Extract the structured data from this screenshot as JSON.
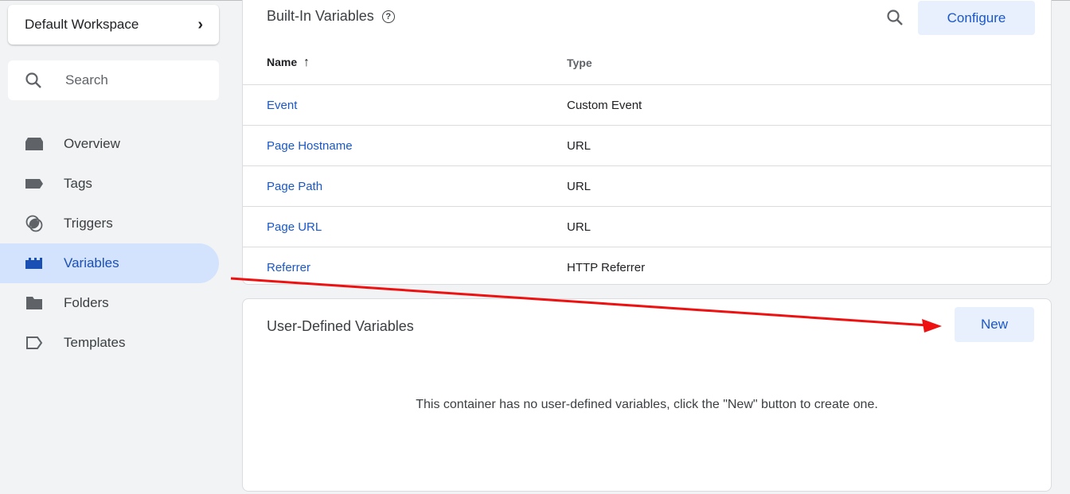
{
  "sidebar": {
    "workspace": {
      "label": "Default Workspace",
      "chevron_icon": "chevron-right-icon"
    },
    "search": {
      "placeholder": "Search",
      "icon": "search-icon"
    },
    "items": [
      {
        "label": "Overview",
        "icon": "overview-icon",
        "active": false
      },
      {
        "label": "Tags",
        "icon": "tag-icon",
        "active": false
      },
      {
        "label": "Triggers",
        "icon": "trigger-icon",
        "active": false
      },
      {
        "label": "Variables",
        "icon": "variables-icon",
        "active": true
      },
      {
        "label": "Folders",
        "icon": "folder-icon",
        "active": false
      },
      {
        "label": "Templates",
        "icon": "template-icon",
        "active": false
      }
    ]
  },
  "builtin": {
    "title": "Built-In Variables",
    "help_icon": "?",
    "configure_label": "Configure",
    "columns": {
      "name": "Name",
      "sort_icon": "↑",
      "type": "Type"
    },
    "rows": [
      {
        "name": "Event",
        "type": "Custom Event"
      },
      {
        "name": "Page Hostname",
        "type": "URL"
      },
      {
        "name": "Page Path",
        "type": "URL"
      },
      {
        "name": "Page URL",
        "type": "URL"
      },
      {
        "name": "Referrer",
        "type": "HTTP Referrer"
      }
    ]
  },
  "user_defined": {
    "title": "User-Defined Variables",
    "new_label": "New",
    "empty_message": "This container has no user-defined variables, click the \"New\" button to create one."
  },
  "annotation": {
    "type": "arrow",
    "color": "#ee1111",
    "points_to": "new-button"
  }
}
